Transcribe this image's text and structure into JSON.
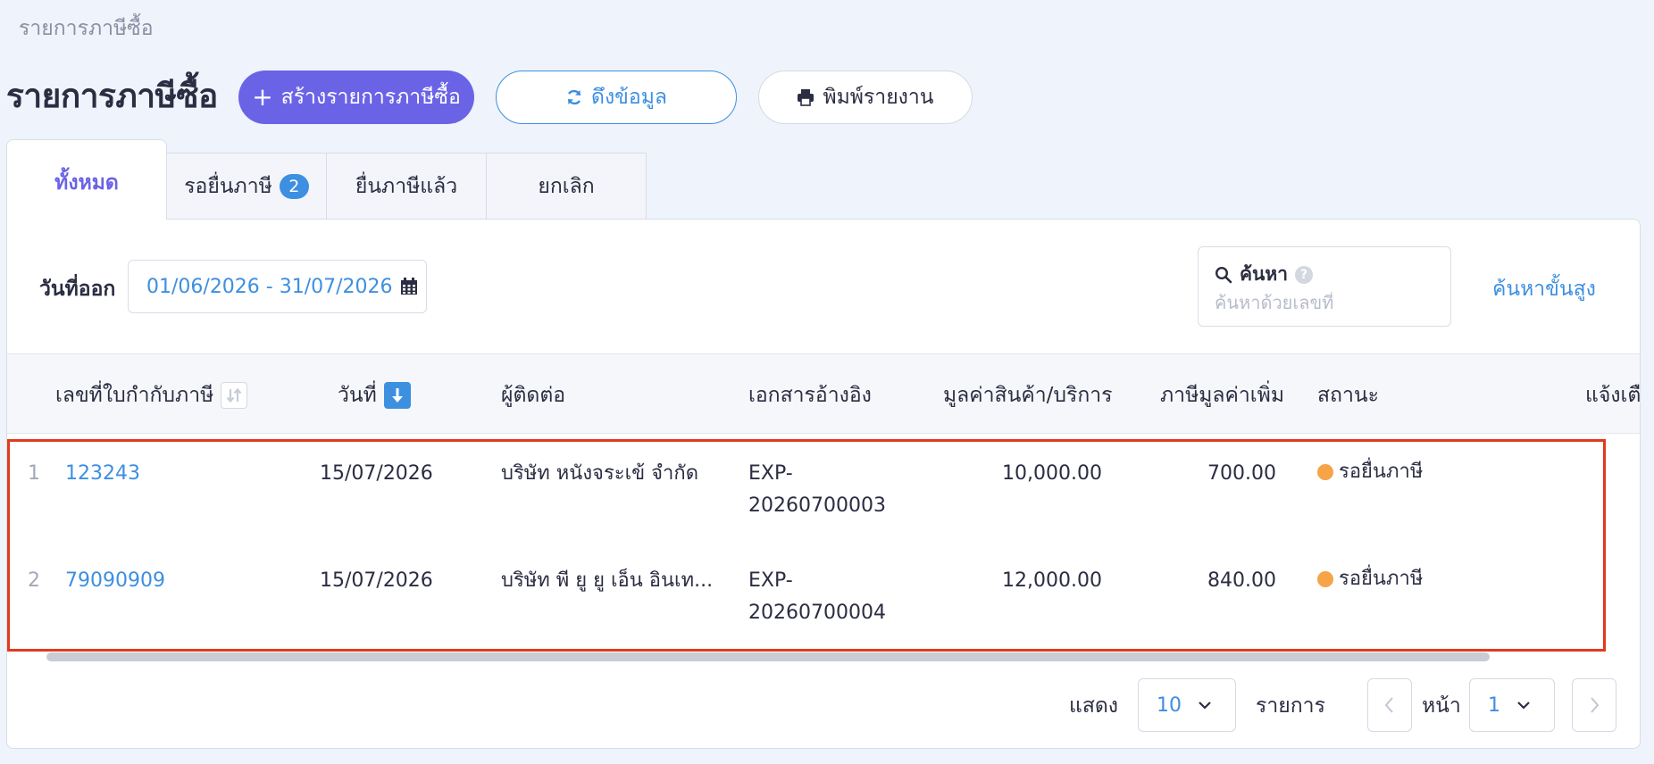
{
  "breadcrumb": "รายการภาษีซื้อ",
  "page_title": "รายการภาษีซื้อ",
  "toolbar": {
    "create_label": "สร้างรายการภาษีซื้อ",
    "pull_label": "ดึงข้อมูล",
    "print_label": "พิมพ์รายงาน"
  },
  "tabs": [
    {
      "label": "ทั้งหมด",
      "active": true
    },
    {
      "label": "รอยื่นภาษี",
      "badge": "2"
    },
    {
      "label": "ยื่นภาษีแล้ว"
    },
    {
      "label": "ยกเลิก"
    }
  ],
  "filters": {
    "date_label": "วันที่ออก",
    "date_range": "01/06/2026 - 31/07/2026",
    "search_label": "ค้นหา",
    "search_placeholder": "ค้นหาด้วยเลขที่",
    "advanced_label": "ค้นหาขั้นสูง"
  },
  "table": {
    "columns": [
      "เลขที่ใบกำกับภาษี",
      "วันที่",
      "ผู้ติดต่อ",
      "เอกสารอ้างอิง",
      "มูลค่าสินค้า/บริการ",
      "ภาษีมูลค่าเพิ่ม",
      "สถานะ",
      "แจ้งเตื"
    ],
    "rows": [
      {
        "num": "1",
        "invoice": "123243",
        "date": "15/07/2026",
        "contact": "บริษัท หนังจระเข้ จำกัด",
        "ref_line1": "EXP-",
        "ref_line2": "20260700003",
        "amount": "10,000.00",
        "vat": "700.00",
        "status": "รอยื่นภาษี"
      },
      {
        "num": "2",
        "invoice": "79090909",
        "date": "15/07/2026",
        "contact": "บริษัท พี ยู ยู เอ็น อินเท...",
        "ref_line1": "EXP-",
        "ref_line2": "20260700004",
        "amount": "12,000.00",
        "vat": "840.00",
        "status": "รอยื่นภาษี"
      }
    ]
  },
  "footer": {
    "show_label": "แสดง",
    "page_size": "10",
    "items_label": "รายการ",
    "page_label": "หน้า",
    "page": "1"
  },
  "colors": {
    "accent": "#6b63e6",
    "link": "#3d8fe0",
    "pending_status": "#f5a447",
    "highlight": "#e03a1f"
  }
}
